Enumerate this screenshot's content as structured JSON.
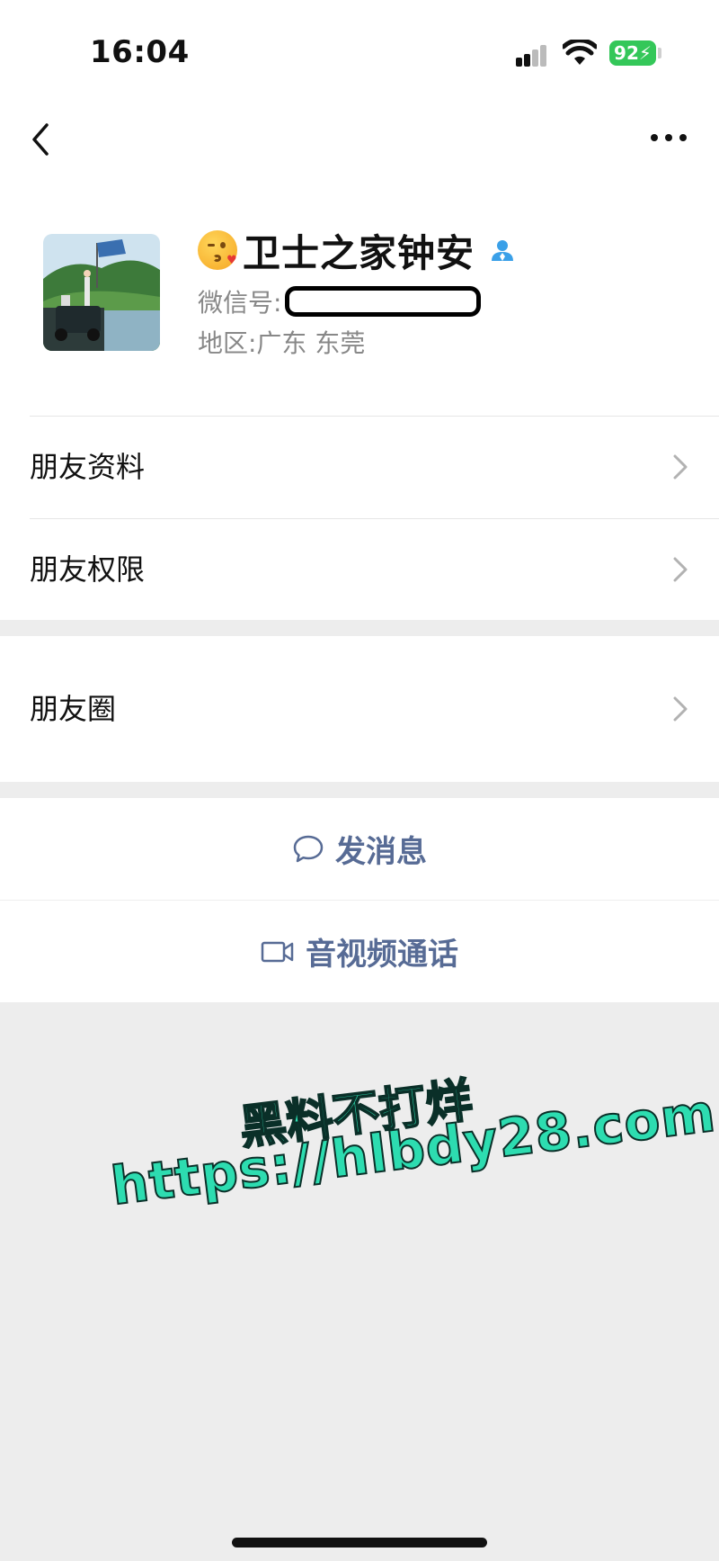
{
  "status_bar": {
    "time": "16:04",
    "battery": "92"
  },
  "nav": {
    "back_icon": "chevron-left-icon",
    "more_icon": "ellipsis-icon"
  },
  "profile": {
    "emoji": "kissing-face-icon",
    "nickname": "卫士之家钟安",
    "wechat_id_label": "微信号:",
    "region": "地区:广东 东莞"
  },
  "menu": {
    "friend_info": "朋友资料",
    "friend_permissions": "朋友权限",
    "moments": "朋友圈"
  },
  "actions": {
    "send_message": "发消息",
    "av_call": "音视频通话"
  },
  "watermark": {
    "line1": "黑料不打烊",
    "line2": "https://hlbdy28.com"
  },
  "colors": {
    "link_blue": "#576b95",
    "battery_green": "#34c759",
    "watermark_green": "#2ddcb0"
  }
}
